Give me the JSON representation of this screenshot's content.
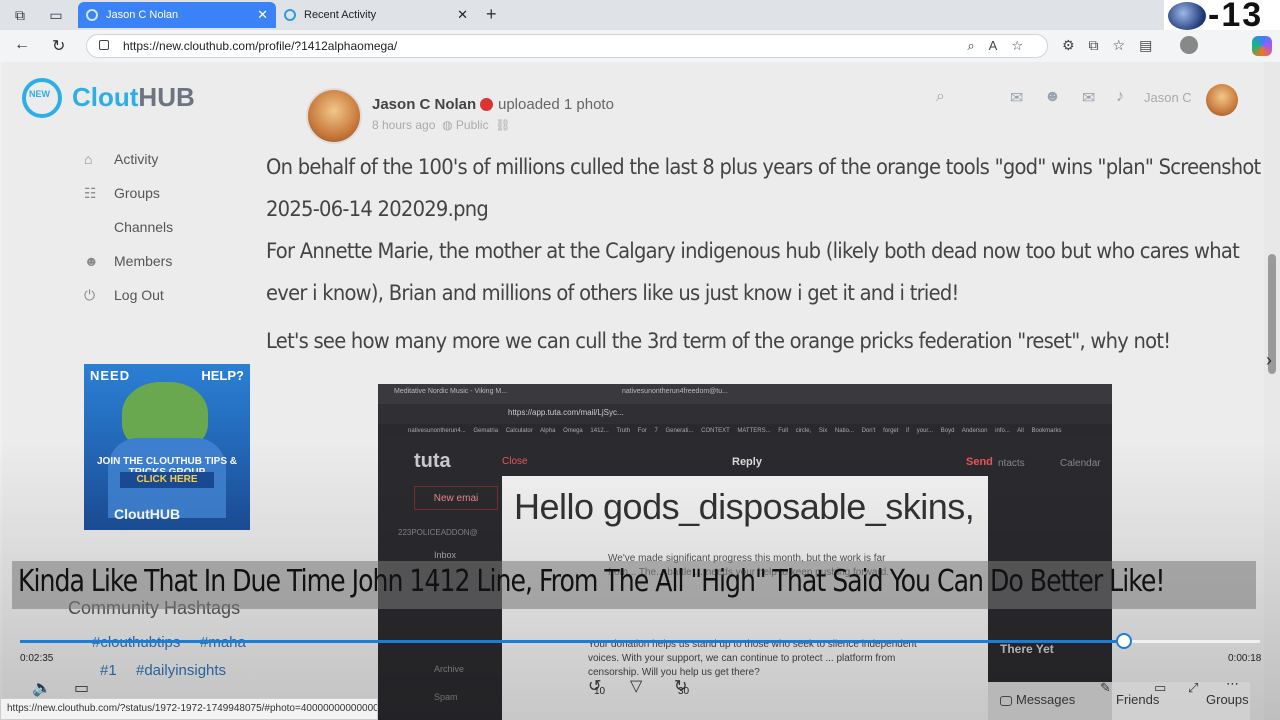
{
  "browser": {
    "tabs": [
      {
        "label": "Jason C Nolan",
        "active": true
      },
      {
        "label": "Recent Activity",
        "active": false
      }
    ],
    "url": "https://new.clouthub.com/profile/?1412alphaomega/",
    "overlay_number": "-13"
  },
  "logo": {
    "badge": "NEW",
    "brand_main": "Clout",
    "brand_hub": "HUB"
  },
  "sidebar": {
    "items": [
      {
        "label": "Activity",
        "icon": "home-icon"
      },
      {
        "label": "Groups",
        "icon": "groups-icon"
      },
      {
        "label": "Channels",
        "icon": ""
      },
      {
        "label": "Members",
        "icon": "members-icon"
      },
      {
        "label": "Log Out",
        "icon": "power-icon"
      }
    ]
  },
  "promo": {
    "need": "NEED",
    "help": "HELP?",
    "join": "JOIN THE CLOUTHUB TIPS & TRICKS GROUP",
    "click": "CLICK HERE",
    "brand": "CloutHUB"
  },
  "hashtags": {
    "title": "Community Hashtags",
    "tags": [
      "#clouthubtips",
      "#maha",
      "#1",
      "#dailyinsights"
    ]
  },
  "header_right": {
    "user_name": "Jason C"
  },
  "post": {
    "author": "Jason C Nolan",
    "action": "uploaded 1 photo",
    "time": "8 hours ago",
    "visibility": "Public",
    "paragraph1": "On behalf of the 100's of millions culled the last 8 plus years of the orange tools \"god\" wins \"plan\" Screenshot 2025-06-14 202029.png",
    "paragraph2": "For Annette Marie, the mother at the Calgary indigenous hub (likely both dead now too but who cares what ever i know), Brian and millions of others like us just know i get it and i tried!",
    "paragraph3": "Let's see how many more we can cull the 3rd term of the orange pricks federation \"reset\", why not!"
  },
  "attachment": {
    "tab1": "Meditative Nordic Music - Viking M...",
    "tab2": "nativesunontherun4freedom@tu...",
    "url": "https://app.tuta.com/mail/LjSyc...",
    "bookmarks": "nativesunontherun4... Gematria Calculator Alpha Omega 1412... Truth For 7 Generati... CONTEXT MATTERS... Full circle, Six Natio... Don't forget if your... Boyd Anderson info... All Bookmarks",
    "app": "tuta",
    "close": "Close",
    "reply": "Reply",
    "send": "Send",
    "contacts": "ntacts",
    "calendar": "Calendar",
    "new_email": "New emai",
    "account": "223POLICEADDON@",
    "inbox": "Inbox",
    "hello": "Hello gods_disposable_skins,",
    "lines": "We've made significant progress this month, but the work is far from... The... battle ... needs your help to keep pushing forward.",
    "donate": "Your donation helps us stand up to those who seek to silence independent voices. With your support, we can continue to protect ... platform from censorship. Will you help us get there?",
    "there_yet": "There Yet",
    "archive": "Archive",
    "spam": "Spam"
  },
  "video": {
    "caption": "Kinda Like That In Due Time John 1412 Line, From The All \"High\" That Said You Can Do Better Like!",
    "time_current": "0:02:35",
    "time_remaining": "0:00:18",
    "progress": 0.89,
    "skip_back": "10",
    "skip_forward": "30"
  },
  "status_url": "https://new.clouthub.com/?status/1972-1972-1749948075/#photo=4000000000000024855",
  "chat_bar": {
    "messages": "Messages",
    "friends": "Friends",
    "groups": "Groups"
  }
}
